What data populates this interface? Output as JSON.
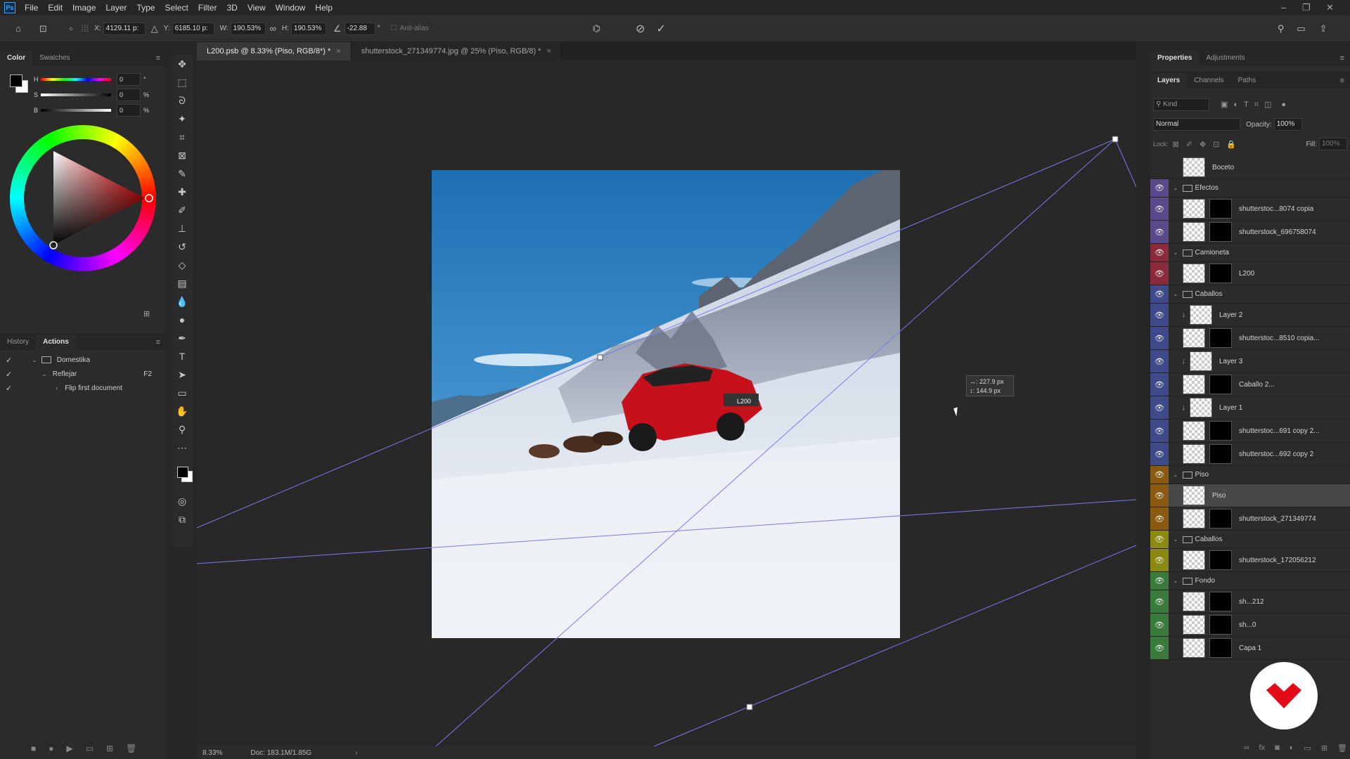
{
  "menubar": {
    "app_icon": "Ps",
    "items": [
      "File",
      "Edit",
      "Image",
      "Layer",
      "Type",
      "Select",
      "Filter",
      "3D",
      "View",
      "Window",
      "Help"
    ]
  },
  "options": {
    "x_label": "X:",
    "x_value": "4129.11 p:",
    "y_label": "Y:",
    "y_value": "6185.10 p:",
    "w_label": "W:",
    "w_value": "190.53%",
    "h_label": "H:",
    "h_value": "190.53%",
    "angle_value": "-22.88",
    "angle_unit": "°",
    "antialias_label": "Anti-alias"
  },
  "color_panel": {
    "tabs": [
      "Color",
      "Swatches"
    ],
    "sliders": [
      {
        "label": "H",
        "value": "0",
        "unit": "°"
      },
      {
        "label": "S",
        "value": "0",
        "unit": "%"
      },
      {
        "label": "B",
        "value": "0",
        "unit": "%"
      }
    ]
  },
  "history_panel": {
    "tabs": [
      "History",
      "Actions"
    ],
    "items": [
      {
        "label": "Domestika",
        "shortcut": "",
        "indent": 0
      },
      {
        "label": "Reflejar",
        "shortcut": "F2",
        "indent": 1
      },
      {
        "label": "Flip first document",
        "shortcut": "",
        "indent": 2
      }
    ]
  },
  "doc_tabs": [
    {
      "label": "L200.psb @ 8.33% (Piso, RGB/8*) *",
      "active": true
    },
    {
      "label": "shutterstock_271349774.jpg @ 25% (Piso, RGB/8) *",
      "active": false
    }
  ],
  "canvas": {
    "truck_badge": "L200",
    "readout_w": "↔: 227.9 px",
    "readout_h": "↕: 144.9 px"
  },
  "status": {
    "zoom": "8.33%",
    "doc": "Doc: 183.1M/1.85G"
  },
  "properties_tabs": [
    "Properties",
    "Adjustments"
  ],
  "layers_tabs": [
    "Layers",
    "Channels",
    "Paths"
  ],
  "layers_filter": {
    "kind_placeholder": "Kind",
    "blend_mode": "Normal",
    "opacity_label": "Opacity:",
    "opacity_value": "100%",
    "lock_label": "Lock:",
    "fill_label": "Fill:",
    "fill_value": "100%"
  },
  "layers": [
    {
      "name": "Boceto",
      "type": "layer",
      "color": "#2b2b2b",
      "visible": false
    },
    {
      "name": "Efectos",
      "type": "group",
      "color": "#5a4a8a",
      "visible": true
    },
    {
      "name": "shutterstoc...8074 copia",
      "type": "masked",
      "color": "#5a4a8a",
      "visible": true
    },
    {
      "name": "shutterstock_696758074",
      "type": "masked",
      "color": "#5a4a8a",
      "visible": true
    },
    {
      "name": "Camioneta",
      "type": "group",
      "color": "#8a2a3a",
      "visible": true
    },
    {
      "name": "L200",
      "type": "masked",
      "color": "#8a2a3a",
      "visible": true
    },
    {
      "name": "Caballos",
      "type": "group",
      "color": "#3e4a8a",
      "visible": true
    },
    {
      "name": "Layer 2",
      "type": "clipped",
      "color": "#3e4a8a",
      "visible": true
    },
    {
      "name": "shutterstoc...8510 copia...",
      "type": "masked",
      "color": "#3e4a8a",
      "visible": true
    },
    {
      "name": "Layer 3",
      "type": "clipped",
      "color": "#3e4a8a",
      "visible": true
    },
    {
      "name": "Caballo 2...",
      "type": "masked",
      "color": "#3e4a8a",
      "visible": true
    },
    {
      "name": "Layer 1",
      "type": "clipped",
      "color": "#3e4a8a",
      "visible": true
    },
    {
      "name": "shutterstoc...691 copy 2...",
      "type": "masked",
      "color": "#3e4a8a",
      "visible": true
    },
    {
      "name": "shutterstoc...692 copy 2",
      "type": "masked",
      "color": "#3e4a8a",
      "visible": true
    },
    {
      "name": "Piso",
      "type": "group",
      "color": "#8a5a10",
      "visible": true
    },
    {
      "name": "Piso",
      "type": "smart",
      "color": "#8a5a10",
      "visible": true,
      "selected": true
    },
    {
      "name": "shutterstock_271349774",
      "type": "masked",
      "color": "#8a5a10",
      "visible": true
    },
    {
      "name": "Caballos",
      "type": "group",
      "color": "#8a8a10",
      "visible": true
    },
    {
      "name": "shutterstock_172056212",
      "type": "masked",
      "color": "#8a8a10",
      "visible": true
    },
    {
      "name": "Fondo",
      "type": "group",
      "color": "#3a7a3a",
      "visible": true
    },
    {
      "name": "sh...212",
      "type": "masked",
      "color": "#3a7a3a",
      "visible": true
    },
    {
      "name": "sh...0",
      "type": "masked",
      "color": "#3a7a3a",
      "visible": true
    },
    {
      "name": "Capa 1",
      "type": "masked",
      "color": "#3a7a3a",
      "visible": true
    }
  ],
  "icons": {
    "home": "home-icon",
    "move": "move-icon",
    "marquee": "marquee-icon",
    "lasso": "lasso-icon",
    "wand": "magic-wand-icon",
    "crop": "crop-icon",
    "frame": "frame-icon",
    "eyedropper": "eyedropper-icon",
    "heal": "healing-brush-icon",
    "brush": "brush-icon",
    "stamp": "clone-stamp-icon",
    "history_brush": "history-brush-icon",
    "eraser": "eraser-icon",
    "gradient": "gradient-icon",
    "blur": "blur-icon",
    "dodge": "dodge-icon",
    "pen": "pen-icon",
    "type": "type-icon",
    "select": "path-selection-icon",
    "shape": "rectangle-icon",
    "hand": "hand-icon",
    "zoom": "zoom-icon",
    "more": "more-icon"
  },
  "brand_color": "#e30b17"
}
